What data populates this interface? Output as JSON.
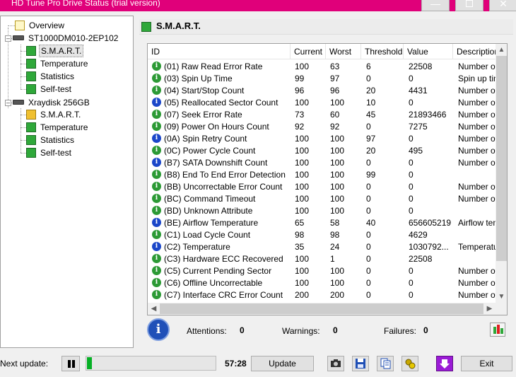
{
  "window": {
    "title": "HD Tune Pro Drive Status (trial version)"
  },
  "tree": {
    "overview": "Overview",
    "drives": [
      {
        "name": "ST1000DM010-2EP102",
        "items": [
          "S.M.A.R.T.",
          "Temperature",
          "Statistics",
          "Self-test"
        ]
      },
      {
        "name": "Xraydisk 256GB",
        "items": [
          "S.M.A.R.T.",
          "Temperature",
          "Statistics",
          "Self-test"
        ]
      }
    ]
  },
  "section": {
    "title": "S.M.A.R.T."
  },
  "table": {
    "headers": [
      "ID",
      "Current",
      "Worst",
      "Threshold",
      "Value",
      "Description"
    ],
    "rows": [
      {
        "status": "ok",
        "id": "(01) Raw Read Error Rate",
        "current": "100",
        "worst": "63",
        "threshold": "6",
        "value": "22508",
        "desc": "Number of"
      },
      {
        "status": "ok",
        "id": "(03) Spin Up Time",
        "current": "99",
        "worst": "97",
        "threshold": "0",
        "value": "0",
        "desc": "Spin up tim"
      },
      {
        "status": "ok",
        "id": "(04) Start/Stop Count",
        "current": "96",
        "worst": "96",
        "threshold": "20",
        "value": "4431",
        "desc": "Number of"
      },
      {
        "status": "info",
        "id": "(05) Reallocated Sector Count",
        "current": "100",
        "worst": "100",
        "threshold": "10",
        "value": "0",
        "desc": "Number of"
      },
      {
        "status": "ok",
        "id": "(07) Seek Error Rate",
        "current": "73",
        "worst": "60",
        "threshold": "45",
        "value": "21893466",
        "desc": "Number of"
      },
      {
        "status": "ok",
        "id": "(09) Power On Hours Count",
        "current": "92",
        "worst": "92",
        "threshold": "0",
        "value": "7275",
        "desc": "Number of"
      },
      {
        "status": "info",
        "id": "(0A) Spin Retry Count",
        "current": "100",
        "worst": "100",
        "threshold": "97",
        "value": "0",
        "desc": "Number of"
      },
      {
        "status": "ok",
        "id": "(0C) Power Cycle Count",
        "current": "100",
        "worst": "100",
        "threshold": "20",
        "value": "495",
        "desc": "Number of"
      },
      {
        "status": "info",
        "id": "(B7) SATA Downshift Count",
        "current": "100",
        "worst": "100",
        "threshold": "0",
        "value": "0",
        "desc": "Number of"
      },
      {
        "status": "ok",
        "id": "(B8) End To End Error Detection",
        "current": "100",
        "worst": "100",
        "threshold": "99",
        "value": "0",
        "desc": ""
      },
      {
        "status": "ok",
        "id": "(BB) Uncorrectable Error Count",
        "current": "100",
        "worst": "100",
        "threshold": "0",
        "value": "0",
        "desc": "Number of"
      },
      {
        "status": "ok",
        "id": "(BC) Command Timeout",
        "current": "100",
        "worst": "100",
        "threshold": "0",
        "value": "0",
        "desc": "Number of"
      },
      {
        "status": "ok",
        "id": "(BD) Unknown Attribute",
        "current": "100",
        "worst": "100",
        "threshold": "0",
        "value": "0",
        "desc": ""
      },
      {
        "status": "info",
        "id": "(BE) Airflow Temperature",
        "current": "65",
        "worst": "58",
        "threshold": "40",
        "value": "656605219",
        "desc": "Airflow temp"
      },
      {
        "status": "ok",
        "id": "(C1) Load Cycle Count",
        "current": "98",
        "worst": "98",
        "threshold": "0",
        "value": "4629",
        "desc": ""
      },
      {
        "status": "info",
        "id": "(C2) Temperature",
        "current": "35",
        "worst": "24",
        "threshold": "0",
        "value": "1030792...",
        "desc": "Temperatur"
      },
      {
        "status": "ok",
        "id": "(C3) Hardware ECC Recovered",
        "current": "100",
        "worst": "1",
        "threshold": "0",
        "value": "22508",
        "desc": ""
      },
      {
        "status": "ok",
        "id": "(C5) Current Pending Sector",
        "current": "100",
        "worst": "100",
        "threshold": "0",
        "value": "0",
        "desc": "Number of"
      },
      {
        "status": "ok",
        "id": "(C6) Offline Uncorrectable",
        "current": "100",
        "worst": "100",
        "threshold": "0",
        "value": "0",
        "desc": "Number of"
      },
      {
        "status": "ok",
        "id": "(C7) Interface CRC Error Count",
        "current": "200",
        "worst": "200",
        "threshold": "0",
        "value": "0",
        "desc": "Number of"
      }
    ]
  },
  "summary": {
    "attentions_label": "Attentions:",
    "attentions": "0",
    "warnings_label": "Warnings:",
    "warnings": "0",
    "failures_label": "Failures:",
    "failures": "0"
  },
  "bottom": {
    "next_update_label": "Next update:",
    "progress_fraction": 0.04,
    "time": "57:28",
    "update_label": "Update",
    "exit_label": "Exit"
  },
  "icons": {
    "status_ok": "green-info-icon",
    "status_info": "blue-info-icon"
  }
}
